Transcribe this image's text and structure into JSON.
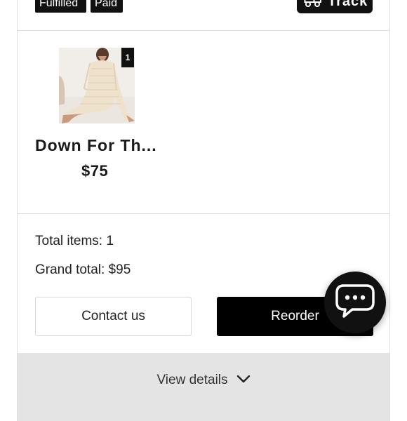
{
  "order": {
    "badges": [
      "Fulfilled",
      "Paid"
    ],
    "track_label": "Track"
  },
  "product": {
    "name": "Down For Th...",
    "price": "$75",
    "quantity": "1"
  },
  "summary": {
    "total_items": "Total items: 1",
    "grand_total": "Grand total: $95"
  },
  "actions": {
    "contact_label": "Contact us",
    "reorder_label": "Reorder",
    "view_details_label": "View details"
  },
  "colors": {
    "primary": "#000000",
    "border": "#dedede",
    "details_bg": "#e4e4e4"
  },
  "icons": {
    "track": "truck-icon",
    "view_details": "chevron-down-icon",
    "chat": "chat-bubble-icon"
  }
}
